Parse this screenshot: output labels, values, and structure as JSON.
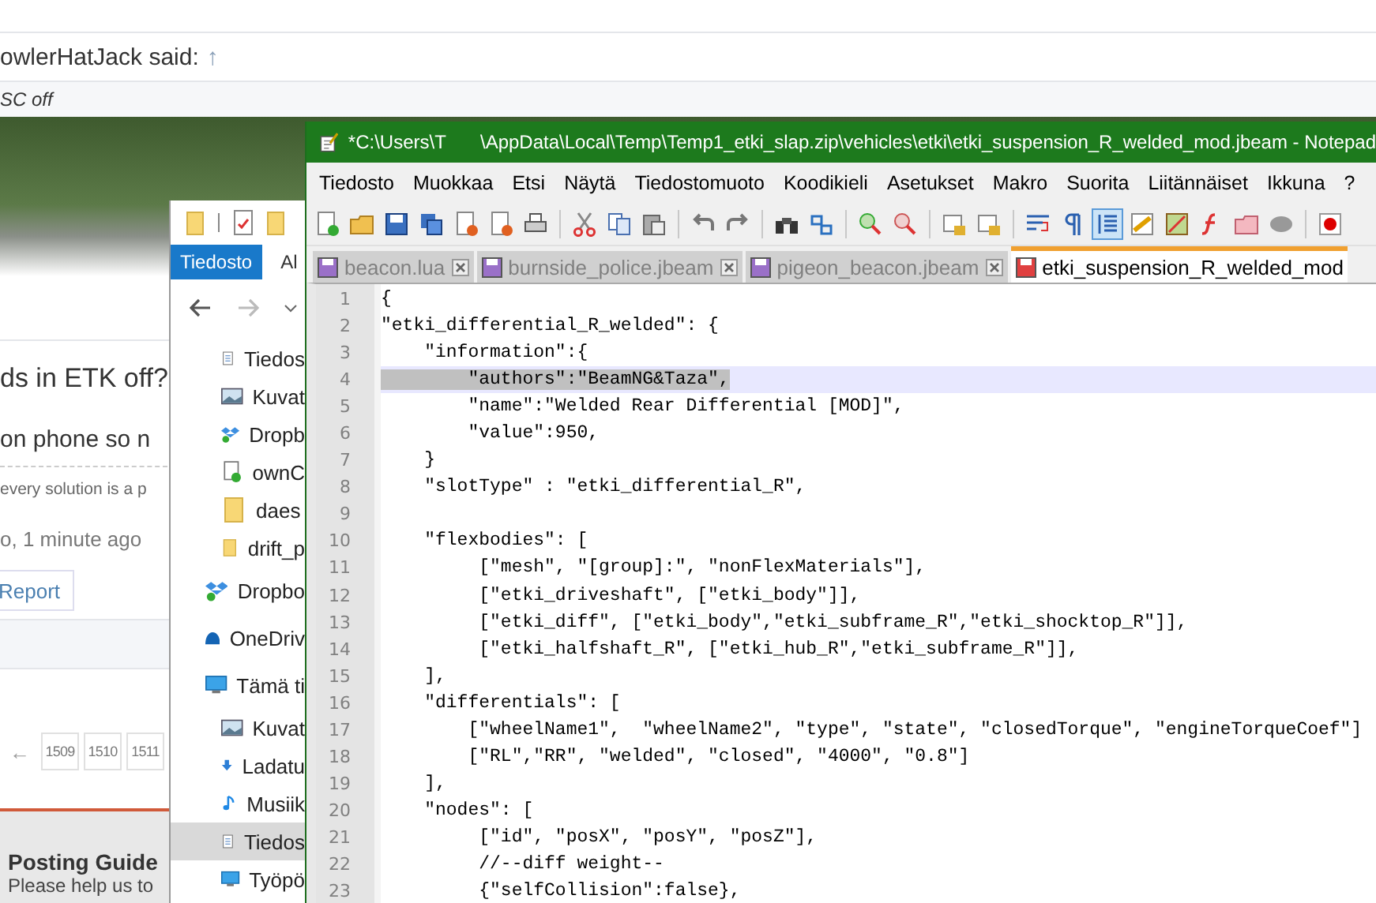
{
  "forum": {
    "quote_author": "owlerHatJack said:",
    "quote_link": "↑",
    "quote_text": "SC off",
    "post_title": "ds in ETK off?",
    "post_body": "on phone so n",
    "signature": "every solution is a p",
    "meta": "o, 1 minute ago",
    "report_button": "Report",
    "pagination": {
      "prev": "←",
      "pages": [
        "1509",
        "1510",
        "1511"
      ]
    },
    "guide_title": "Posting Guide",
    "guide_text": "Please help us to"
  },
  "explorer": {
    "ribbon_tabs": [
      {
        "label": "Tiedosto",
        "selected": true
      },
      {
        "label": "Al",
        "selected": false
      }
    ],
    "quick_access_items": [
      {
        "label": "Tiedos",
        "selected": false
      },
      {
        "label": "Kuvat",
        "selected": false
      },
      {
        "label": "Dropb",
        "selected": false
      },
      {
        "label": "ownC",
        "selected": false
      },
      {
        "label": "daes",
        "selected": false
      },
      {
        "label": "drift_p",
        "selected": false
      }
    ],
    "nav_items": [
      {
        "label": "Dropbo",
        "selected": false
      },
      {
        "label": "OneDriv",
        "selected": false
      },
      {
        "label": "Tämä ti",
        "selected": false,
        "children": [
          {
            "label": "Kuvat",
            "selected": false
          },
          {
            "label": "Ladatu",
            "selected": false
          },
          {
            "label": "Musiik",
            "selected": false
          },
          {
            "label": "Tiedos",
            "selected": true
          },
          {
            "label": "Työpö",
            "selected": false
          }
        ]
      }
    ]
  },
  "notepad": {
    "title": [
      "*C:\\Users\\T",
      "\\AppData\\Local\\Temp\\Temp1_etki_slap.zip\\vehicles\\etki\\etki_suspension_R_welded_mod.jbeam - Notepad"
    ],
    "menu": [
      "Tiedosto",
      "Muokkaa",
      "Etsi",
      "Näytä",
      "Tiedostomuoto",
      "Koodikieli",
      "Asetukset",
      "Makro",
      "Suorita",
      "Liitännäiset",
      "Ikkuna",
      "?"
    ],
    "toolbar": [
      {
        "on": false
      },
      {
        "on": false
      },
      {
        "on": false
      },
      {
        "on": false
      },
      {
        "on": false
      },
      {
        "on": false
      },
      {
        "on": false
      },
      {
        "on": false
      },
      {
        "on": false
      },
      {
        "on": false
      },
      {
        "on": false
      },
      {
        "on": false
      },
      {
        "on": false
      },
      {
        "on": false
      },
      {
        "on": false
      },
      {
        "on": false
      },
      {
        "on": false
      },
      {
        "on": false
      },
      {
        "on": false
      },
      {
        "on": false
      },
      {
        "on": true
      },
      {
        "on": false
      },
      {
        "on": false
      },
      {
        "on": false
      },
      {
        "on": false
      },
      {
        "on": false
      },
      {
        "on": false
      }
    ],
    "tabs": [
      {
        "label": "beacon.lua",
        "selected": false,
        "modified": false
      },
      {
        "label": "burnside_police.jbeam",
        "selected": false,
        "modified": false
      },
      {
        "label": "pigeon_beacon.jbeam",
        "selected": false,
        "modified": false
      },
      {
        "label": "etki_suspension_R_welded_mod",
        "selected": true,
        "modified": true
      }
    ],
    "lines": [
      {
        "number": "1",
        "text": "{",
        "current": false
      },
      {
        "number": "2",
        "text": "\"etki_differential_R_welded\": {",
        "current": false
      },
      {
        "number": "3",
        "text": "    \"information\":{",
        "current": false
      },
      {
        "number": "4",
        "text": "        \"authors\":\"BeamNG&Taza\",",
        "current": true
      },
      {
        "number": "5",
        "text": "        \"name\":\"Welded Rear Differential [MOD]\",",
        "current": false
      },
      {
        "number": "6",
        "text": "        \"value\":950,",
        "current": false
      },
      {
        "number": "7",
        "text": "    }",
        "current": false
      },
      {
        "number": "8",
        "text": "    \"slotType\" : \"etki_differential_R\",",
        "current": false
      },
      {
        "number": "9",
        "current": false
      },
      {
        "number": "10",
        "text": "    \"flexbodies\": [",
        "current": false
      },
      {
        "number": "11",
        "text": "         [\"mesh\", \"[group]:\", \"nonFlexMaterials\"],",
        "current": false
      },
      {
        "number": "12",
        "text": "         [\"etki_driveshaft\", [\"etki_body\"]],",
        "current": false
      },
      {
        "number": "13",
        "text": "         [\"etki_diff\", [\"etki_body\",\"etki_subframe_R\",\"etki_shocktop_R\"]],",
        "current": false
      },
      {
        "number": "14",
        "text": "         [\"etki_halfshaft_R\", [\"etki_hub_R\",\"etki_subframe_R\"]],",
        "current": false
      },
      {
        "number": "15",
        "text": "    ],",
        "current": false
      },
      {
        "number": "16",
        "text": "    \"differentials\": [",
        "current": false
      },
      {
        "number": "17",
        "text": "        [\"wheelName1\",  \"wheelName2\", \"type\", \"state\", \"closedTorque\", \"engineTorqueCoef\"]",
        "current": false
      },
      {
        "number": "18",
        "text": "        [\"RL\",\"RR\", \"welded\", \"closed\", \"4000\", \"0.8\"]",
        "current": false
      },
      {
        "number": "19",
        "text": "    ],",
        "current": false
      },
      {
        "number": "20",
        "text": "    \"nodes\": [",
        "current": false
      },
      {
        "number": "21",
        "text": "         [\"id\", \"posX\", \"posY\", \"posZ\"],",
        "current": false
      },
      {
        "number": "22",
        "text": "         //--diff weight--",
        "current": false
      },
      {
        "number": "23",
        "text": "         {\"selfCollision\":false},",
        "current": false
      }
    ]
  }
}
